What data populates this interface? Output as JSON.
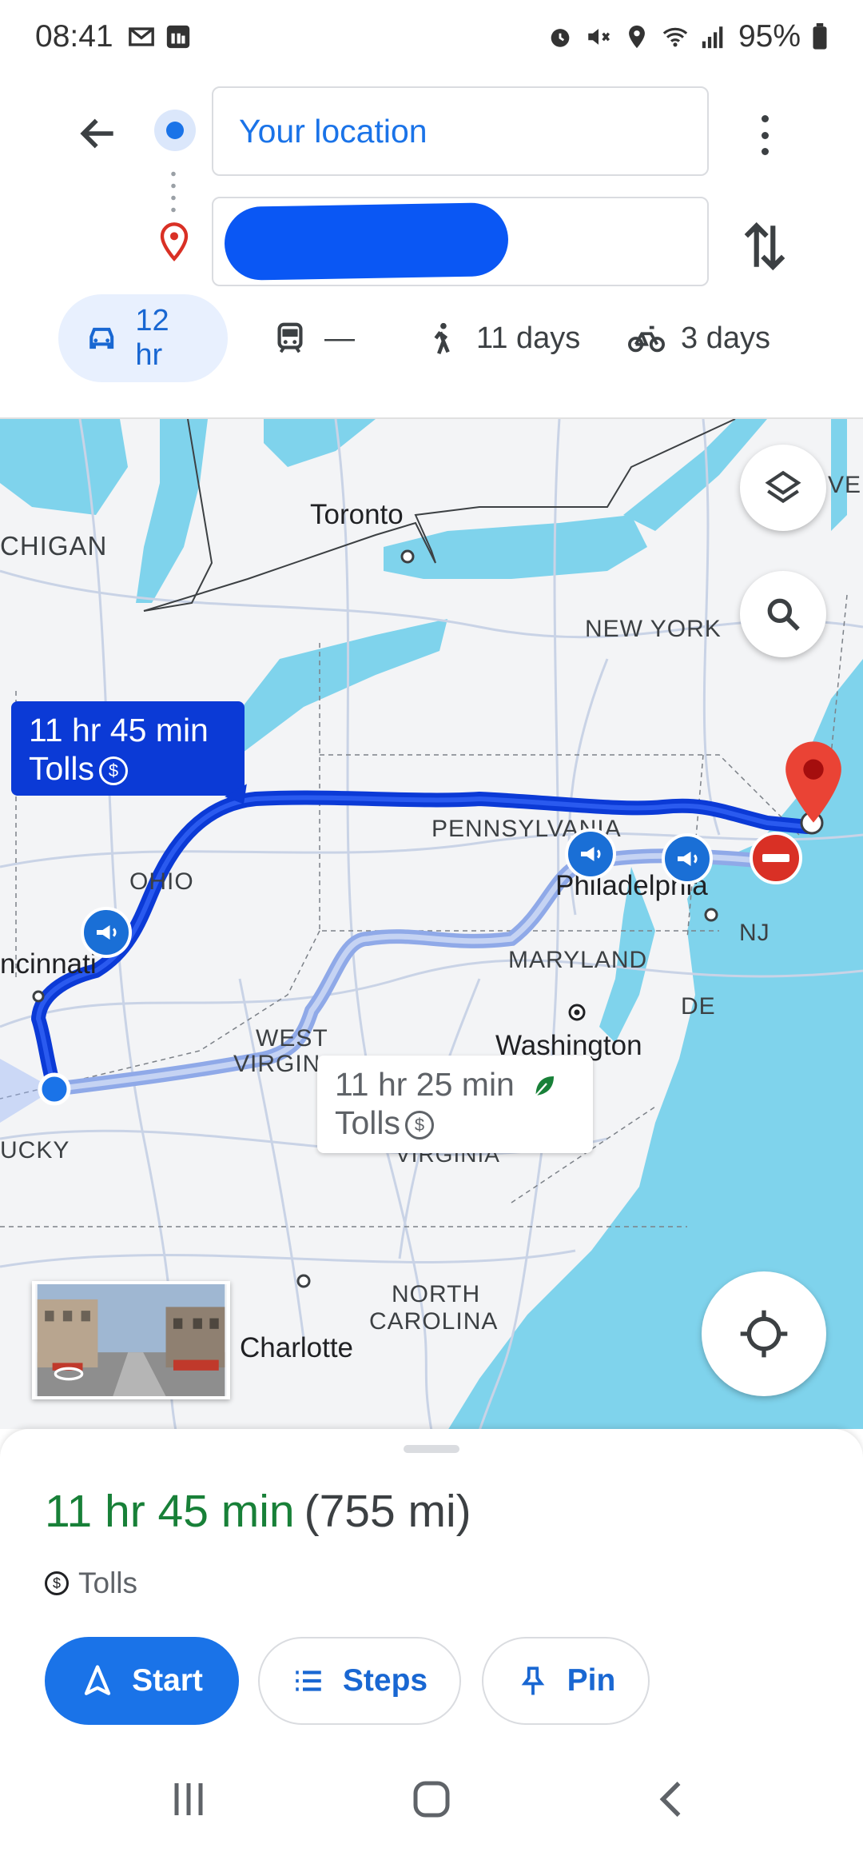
{
  "status_bar": {
    "time": "08:41",
    "battery": "95%",
    "left_icons": [
      "gmail-icon",
      "linkedin-icon"
    ],
    "right_icons": [
      "alarm-icon",
      "mute-icon",
      "location-icon",
      "wifi-icon",
      "signal-icon",
      "battery-icon"
    ]
  },
  "search": {
    "origin_value": "Your location",
    "destination_value": ""
  },
  "modes": [
    {
      "name": "car",
      "label": "12 hr",
      "active": true
    },
    {
      "name": "transit",
      "label": "—",
      "active": false
    },
    {
      "name": "walk",
      "label": "11 days",
      "active": false
    },
    {
      "name": "bike",
      "label": "3 days",
      "active": false
    }
  ],
  "map": {
    "labels": {
      "michigan": "CHIGAN",
      "toronto": "Toronto",
      "new_york": "NEW YORK",
      "pennsylvania": "PENNSYLVANIA",
      "ohio": "OHIO",
      "cincinnati": "ncinnati",
      "philadelphia": "Philadelphia",
      "nj": "NJ",
      "maryland": "MARYLAND",
      "de": "DE",
      "washington": "Washington",
      "west_virginia_1": "WEST",
      "west_virginia_2": "VIRGIN",
      "virginia": "VIRGINIA",
      "kentucky": "UCKY",
      "north_carolina_1": "NORTH",
      "north_carolina_2": "CAROLINA",
      "charlotte": "Charlotte",
      "vermont": "VE"
    },
    "route_main": {
      "duration": "11 hr 45 min",
      "tolls": "Tolls"
    },
    "route_alt": {
      "duration": "11 hr 25 min",
      "tolls": "Tolls"
    }
  },
  "sheet": {
    "duration": "11 hr 45 min",
    "distance": "(755 mi)",
    "tolls": "Tolls",
    "start_label": "Start",
    "steps_label": "Steps",
    "pin_label": "Pin"
  },
  "colors": {
    "accent": "#1a73e8",
    "route_main": "#0b3ad6",
    "route_alt": "#8fa9e8",
    "duration_green": "#188038",
    "water": "#7fd3ec",
    "destination_red": "#d93025"
  }
}
